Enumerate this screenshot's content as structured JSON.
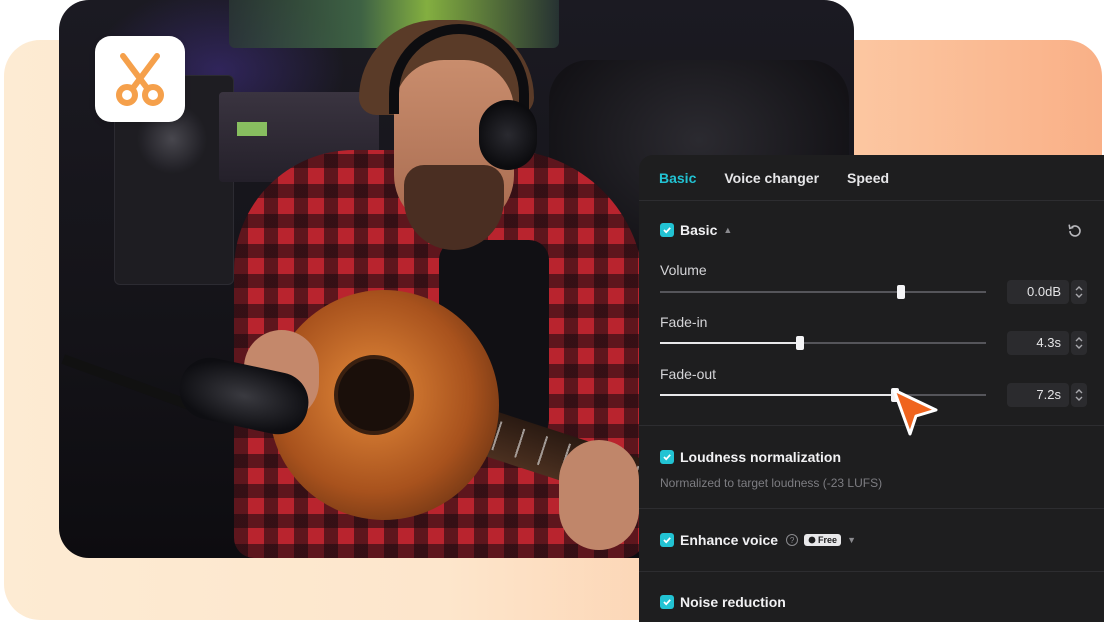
{
  "colors": {
    "accent": "#22c3d3",
    "cursor": "#f0641e",
    "app_icon": "#f5a04b",
    "panel_bg": "#1e1e1f"
  },
  "tabs": [
    {
      "label": "Basic",
      "active": true
    },
    {
      "label": "Voice changer",
      "active": false
    },
    {
      "label": "Speed",
      "active": false
    }
  ],
  "basic": {
    "title": "Basic",
    "checked": true,
    "icons": [
      "caret-up-icon",
      "reset-icon"
    ],
    "volume": {
      "label": "Volume",
      "value": "0.0dB",
      "level_pct": 74
    },
    "fade_in": {
      "label": "Fade-in",
      "value": "4.3s",
      "level_pct": 43
    },
    "fade_out": {
      "label": "Fade-out",
      "value": "7.2s",
      "level_pct": 72
    }
  },
  "loudness": {
    "title": "Loudness normalization",
    "checked": true,
    "description": "Normalized to target loudness (-23 LUFS)"
  },
  "enhance": {
    "title": "Enhance voice",
    "checked": true,
    "badge": "Free",
    "icons": [
      "help-icon",
      "caret-down-icon"
    ]
  },
  "noise": {
    "title": "Noise reduction",
    "checked": true
  },
  "app": {
    "icon": "scissors-icon"
  }
}
